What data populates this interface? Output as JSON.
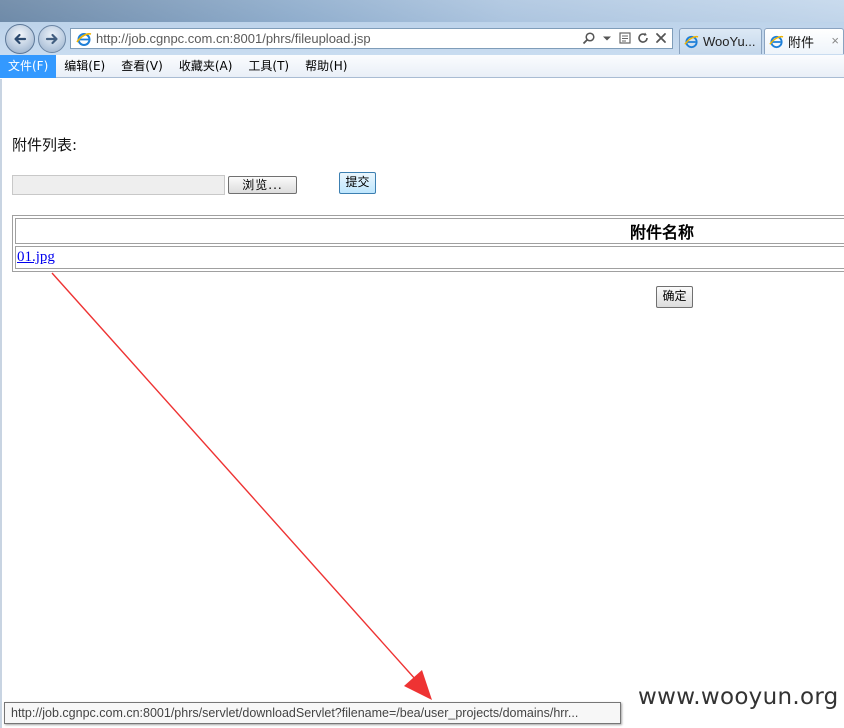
{
  "browser": {
    "url": "http://job.cgnpc.com.cn:8001/phrs/fileupload.jsp",
    "tabs": [
      {
        "label": "WooYu..."
      },
      {
        "label": "附件",
        "close": "×"
      }
    ]
  },
  "menubar": {
    "items": [
      {
        "label": "文件(F)",
        "active": true
      },
      {
        "label": "编辑(E)"
      },
      {
        "label": "查看(V)"
      },
      {
        "label": "收藏夹(A)"
      },
      {
        "label": "工具(T)"
      },
      {
        "label": "帮助(H)"
      }
    ]
  },
  "page": {
    "list_label": "附件列表:",
    "file_input_value": "",
    "browse_label": "浏览...",
    "submit_label": "提交",
    "table_header": "附件名称",
    "files": [
      {
        "name": "01.jpg"
      }
    ],
    "confirm_label": "确定"
  },
  "statusbar": {
    "link_url": "http://job.cgnpc.com.cn:8001/phrs/servlet/downloadServlet?filename=/bea/user_projects/domains/hrr..."
  },
  "watermark": "www.wooyun.org",
  "colors": {
    "annotation_arrow": "#ee3333",
    "link": "#0000ee",
    "menu_active": "#3399ff"
  },
  "icons": {
    "back": "back-arrow-icon",
    "forward": "forward-arrow-icon",
    "page": "ie-page-icon",
    "search": "search-icon",
    "refresh": "refresh-icon",
    "stop": "stop-icon"
  }
}
